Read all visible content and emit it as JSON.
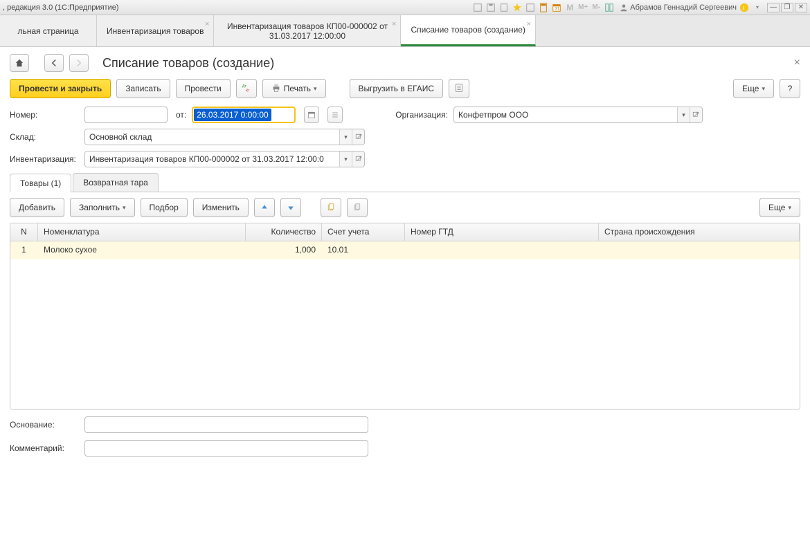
{
  "titlebar": {
    "title": ", редакция 3.0  (1С:Предприятие)",
    "user": "Абрамов Геннадий Сергеевич"
  },
  "tabs": [
    {
      "label": "льная страница",
      "closable": false
    },
    {
      "label": "Инвентаризация товаров",
      "closable": true
    },
    {
      "label": "Инвентаризация товаров КП00-000002 от 31.03.2017 12:00:00",
      "closable": true
    },
    {
      "label": "Списание товаров (создание)",
      "closable": true,
      "active": true
    }
  ],
  "page": {
    "title": "Списание товаров (создание)"
  },
  "toolbar": {
    "post_close": "Провести и закрыть",
    "save": "Записать",
    "post": "Провести",
    "print": "Печать",
    "egais": "Выгрузить в ЕГАИС",
    "more": "Еще",
    "help": "?"
  },
  "form": {
    "number_label": "Номер:",
    "number_value": "",
    "from_label": "от:",
    "date_value": "26.03.2017  0:00:00",
    "org_label": "Организация:",
    "org_value": "Конфетпром ООО",
    "warehouse_label": "Склад:",
    "warehouse_value": "Основной склад",
    "inventory_label": "Инвентаризация:",
    "inventory_value": "Инвентаризация товаров КП00-000002 от 31.03.2017 12:00:0"
  },
  "subtabs": {
    "goods": "Товары (1)",
    "tare": "Возвратная тара"
  },
  "subtoolbar": {
    "add": "Добавить",
    "fill": "Заполнить",
    "pick": "Подбор",
    "edit": "Изменить",
    "more": "Еще"
  },
  "table": {
    "columns": {
      "n": "N",
      "nom": "Номенклатура",
      "qty": "Количество",
      "acct": "Счет учета",
      "gtd": "Номер ГТД",
      "ctry": "Страна происхождения"
    },
    "rows": [
      {
        "n": "1",
        "nom": "Молоко сухое",
        "qty": "1,000",
        "acct": "10.01",
        "gtd": "",
        "ctry": ""
      }
    ]
  },
  "footer": {
    "reason_label": "Основание:",
    "reason_value": "",
    "comment_label": "Комментарий:",
    "comment_value": ""
  }
}
